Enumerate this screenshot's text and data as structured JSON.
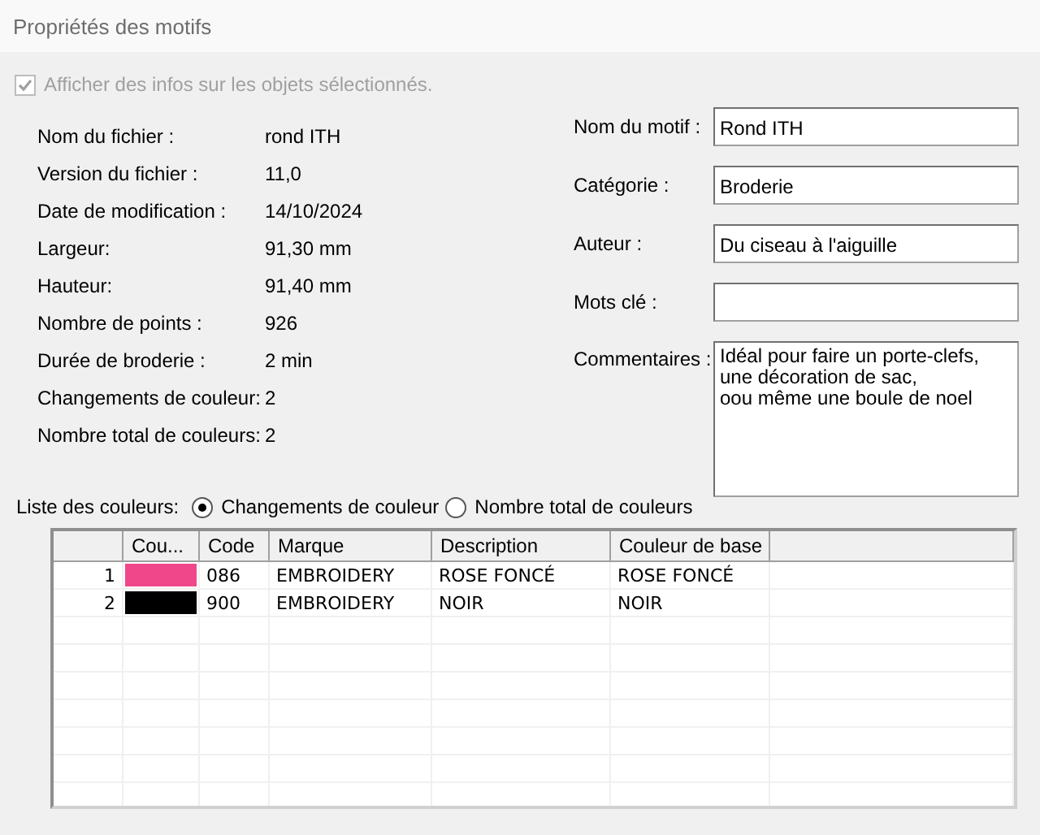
{
  "window": {
    "title": "Propriétés des motifs"
  },
  "show_info": {
    "label": "Afficher des infos sur les objets sélectionnés.",
    "checked": true,
    "disabled": true
  },
  "info": [
    {
      "label": "Nom du fichier :",
      "value": "rond ITH"
    },
    {
      "label": "Version du fichier :",
      "value": "11,0"
    },
    {
      "label": "Date de modification :",
      "value": "14/10/2024"
    },
    {
      "label": "Largeur:",
      "value": "91,30 mm"
    },
    {
      "label": "Hauteur:",
      "value": "91,40 mm"
    },
    {
      "label": "Nombre de points :",
      "value": "926"
    },
    {
      "label": "Durée de broderie :",
      "value": "2 min"
    },
    {
      "label": "Changements de couleur:",
      "value": "2"
    },
    {
      "label": "Nombre total de couleurs:",
      "value": "2"
    }
  ],
  "fields": [
    {
      "label": "Nom du motif :",
      "value": "Rond ITH"
    },
    {
      "label": "Catégorie :",
      "value": "Broderie"
    },
    {
      "label": "Auteur :",
      "value": "Du ciseau à l'aiguille"
    },
    {
      "label": "Mots clé :"
    }
  ],
  "comments": {
    "label": "Commentaires :",
    "value": "Idéal pour faire un porte-clefs,\nune décoration de sac,\noou même une boule de noel"
  },
  "color_list": {
    "label": "Liste des couleurs:",
    "options": [
      {
        "label": "Changements de couleur",
        "selected": true
      },
      {
        "label": "Nombre total de couleurs",
        "selected": false
      }
    ]
  },
  "table": {
    "columns": [
      "Cou...",
      "Code",
      "Marque",
      "Description",
      "Couleur de base"
    ],
    "rows": [
      {
        "index": "1",
        "color": "#f0478a",
        "code": "086",
        "brand": "EMBROIDERY",
        "description": "ROSE FONCÉ",
        "base_color": "ROSE FONCÉ"
      },
      {
        "index": "2",
        "color": "#000000",
        "code": "900",
        "brand": "EMBROIDERY",
        "description": "NOIR",
        "base_color": "NOIR"
      }
    ]
  }
}
